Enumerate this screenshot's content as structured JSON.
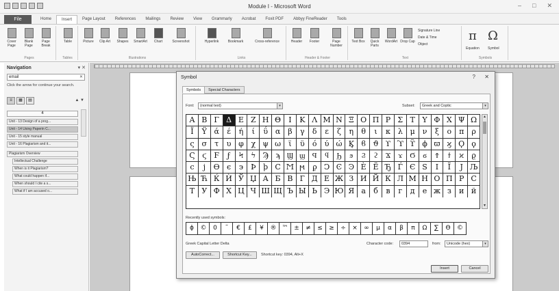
{
  "window": {
    "title": "Module I - Microsoft Word",
    "controls": [
      "–",
      "□",
      "✕"
    ]
  },
  "ribbon_tabs": {
    "file": "File",
    "tabs": [
      "Home",
      "Insert",
      "Page Layout",
      "References",
      "Mailings",
      "Review",
      "View",
      "Grammarly",
      "Acrobat",
      "Foxit PDF",
      "Abbyy FineReader",
      "Tools"
    ],
    "active_index": 1
  },
  "ribbon": {
    "groups": {
      "pages": "Pages",
      "tables": "Tables",
      "illustrations": "Illustrations",
      "links": "Links",
      "header_footer": "Header & Footer",
      "text": "Text",
      "symbols": "Symbols"
    },
    "buttons": {
      "cover_page": "Cover Page",
      "blank_page": "Blank Page",
      "page_break": "Page Break",
      "table": "Table",
      "picture": "Picture",
      "clip_art": "Clip Art",
      "shapes": "Shapes",
      "smartart": "SmartArt",
      "chart": "Chart",
      "screenshot": "Screenshot",
      "hyperlink": "Hyperlink",
      "bookmark": "Bookmark",
      "cross_reference": "Cross-reference",
      "header": "Header",
      "footer": "Footer",
      "page_number": "Page Number",
      "text_box": "Text Box",
      "quick_parts": "Quick Parts",
      "wordart": "WordArt",
      "drop_cap": "Drop Cap",
      "signature_line": "Signature Line",
      "date_time": "Date & Time",
      "object": "Object",
      "equation": "Equation",
      "symbol": "Symbol",
      "equation_glyph": "π",
      "symbol_glyph": "Ω"
    }
  },
  "navigation": {
    "title": "Navigation",
    "close": "▾ ✕",
    "search_value": "email",
    "search_clear": "✕",
    "hint": "Click the arrow for continue your search.",
    "view_icons": [
      "≡",
      "▦",
      "▤"
    ],
    "arrows": "▲ ▼",
    "result_count": "4",
    "results": [
      "Unit - 13 Design of a prog...",
      "Unit - 14 Using Paperin C...",
      "Unit - 15 style manual",
      "Unit - 16 Plagiarism and it...",
      "Plagiarism Overview",
      "Intellectual Challenge",
      "When is it Plagiarism?",
      "What could happen if...",
      "When should I cite a s...",
      "What if I am accused o..."
    ],
    "selected_result": 1
  },
  "symbol_dialog": {
    "title": "Symbol",
    "help": "?",
    "close": "✕",
    "tabs": [
      "Symbols",
      "Special Characters"
    ],
    "font_label": "Font:",
    "font_value": "(normal text)",
    "subset_label": "Subset:",
    "subset_value": "Greek and Coptic",
    "grid": [
      [
        "Α",
        "Β",
        "Γ",
        "Δ",
        "Ε",
        "Ζ",
        "Η",
        "Θ",
        "Ι",
        "Κ",
        "Λ",
        "Μ",
        "Ν",
        "Ξ",
        "Ο",
        "Π",
        "Ρ",
        "Σ",
        "Τ",
        "Υ",
        "Φ",
        "Χ",
        "Ψ",
        "Ω"
      ],
      [
        "Ϊ",
        "Ϋ",
        "ά",
        "έ",
        "ή",
        "ί",
        "ΰ",
        "α",
        "β",
        "γ",
        "δ",
        "ε",
        "ζ",
        "η",
        "θ",
        "ι",
        "κ",
        "λ",
        "μ",
        "ν",
        "ξ",
        "ο",
        "π",
        "ρ"
      ],
      [
        "ς",
        "σ",
        "τ",
        "υ",
        "φ",
        "χ",
        "ψ",
        "ω",
        "ϊ",
        "ϋ",
        "ό",
        "ύ",
        "ώ",
        "Ϗ",
        "ϐ",
        "ϑ",
        "ϒ",
        "ϓ",
        "ϔ",
        "ϕ",
        "ϖ",
        "ϗ",
        "Ϙ",
        "ϙ"
      ],
      [
        "Ϛ",
        "ϛ",
        "Ϝ",
        "ϝ",
        "Ϟ",
        "ϟ",
        "Ϡ",
        "ϡ",
        "Ϣ",
        "ϣ",
        "Ϥ",
        "ϥ",
        "Ϧ",
        "ϧ",
        "Ϩ",
        "ϩ",
        "Ϫ",
        "ϫ",
        "Ϭ",
        "ϭ",
        "Ϯ",
        "ϯ",
        "ϰ",
        "ϱ"
      ],
      [
        "ϲ",
        "ϳ",
        "ϴ",
        "ϵ",
        "϶",
        "Ϸ",
        "ϸ",
        "Ϲ",
        "Ϻ",
        "ϻ",
        "ϼ",
        "Ͻ",
        "Ͼ",
        "Ͽ",
        "Ѐ",
        "Ё",
        "Ђ",
        "Ѓ",
        "Є",
        "Ѕ",
        "І",
        "Ї",
        "Ј",
        "Љ"
      ],
      [
        "Њ",
        "Ћ",
        "Ќ",
        "Ѝ",
        "Ў",
        "Џ",
        "А",
        "Б",
        "В",
        "Г",
        "Д",
        "Е",
        "Ж",
        "З",
        "И",
        "Й",
        "К",
        "Л",
        "М",
        "Н",
        "О",
        "П",
        "Р",
        "С"
      ],
      [
        "Т",
        "У",
        "Ф",
        "Х",
        "Ц",
        "Ч",
        "Ш",
        "Щ",
        "Ъ",
        "Ы",
        "Ь",
        "Э",
        "Ю",
        "Я",
        "а",
        "б",
        "в",
        "г",
        "д",
        "е",
        "ж",
        "з",
        "и",
        "й"
      ]
    ],
    "selected_cell": [
      0,
      3
    ],
    "recent_label": "Recently used symbols:",
    "recent": [
      "ϕ",
      "©",
      "0",
      "˜",
      "€",
      "£",
      "¥",
      "®",
      "™",
      "±",
      "≠",
      "≤",
      "≥",
      "÷",
      "×",
      "∞",
      "µ",
      "α",
      "β",
      "π",
      "Ω",
      "∑",
      "Θ",
      "©"
    ],
    "char_name": "Greek Capital Letter Delta",
    "char_code_label": "Character code:",
    "char_code_value": "0394",
    "from_label": "from:",
    "from_value": "Unicode (hex)",
    "autocorrect": "AutoCorrect...",
    "shortcut_key": "Shortcut Key...",
    "shortcut_text": "Shortcut key: 0394, Alt+X",
    "insert": "Insert",
    "cancel": "Cancel"
  }
}
